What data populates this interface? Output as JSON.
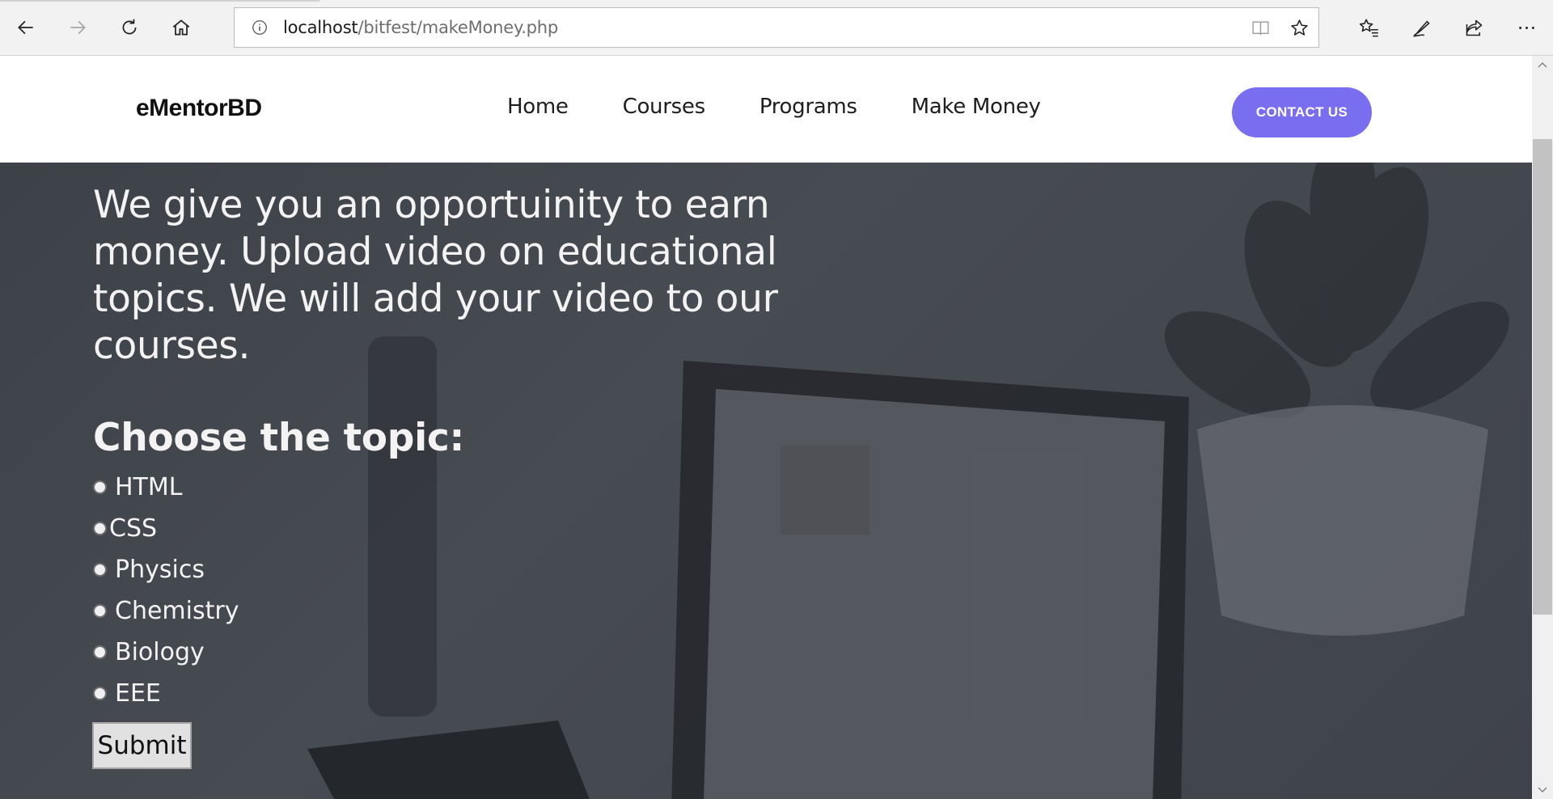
{
  "browser": {
    "url_host": "localhost",
    "url_path": "/bitfest/makeMoney.php",
    "icons": [
      "back-icon",
      "forward-icon",
      "refresh-icon",
      "home-icon",
      "info-icon",
      "reading-view-icon",
      "favorite-star-icon",
      "favorites-list-icon",
      "pen-icon",
      "share-icon",
      "more-icon"
    ]
  },
  "site": {
    "logo": "eMentorBD",
    "nav": [
      "Home",
      "Courses",
      "Programs",
      "Make Money"
    ],
    "contact_label": "CONTACT US",
    "accent": "#7a6ef0"
  },
  "hero": {
    "intro": "We give you an opportuinity to earn money. Upload video on educational topics. We will add your video to our courses.",
    "topic_heading": "Choose the topic:",
    "topics": [
      "HTML",
      "CSS",
      "Physics",
      "Chemistry",
      "Biology",
      "EEE"
    ],
    "submit_label": "Submit"
  }
}
